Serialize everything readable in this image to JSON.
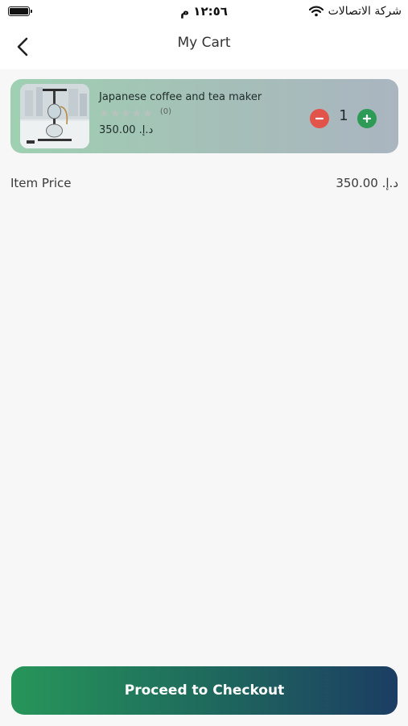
{
  "status_bar": {
    "time": "١٢:٥٦ م",
    "carrier": "شركة الاتصالات"
  },
  "header": {
    "title": "My Cart"
  },
  "cart": {
    "items": [
      {
        "name": "Japanese coffee and tea maker",
        "rating_count": "(0)",
        "price": "د.إ. 350.00",
        "quantity": "1"
      }
    ]
  },
  "summary": {
    "item_price_label": "Item Price",
    "item_price_value": "د.إ. 350.00"
  },
  "checkout": {
    "label": "Proceed to Checkout"
  },
  "colors": {
    "minus": "#e2534a",
    "plus": "#2d9a55",
    "checkout_start": "#27965a",
    "checkout_end": "#1c3d63"
  }
}
